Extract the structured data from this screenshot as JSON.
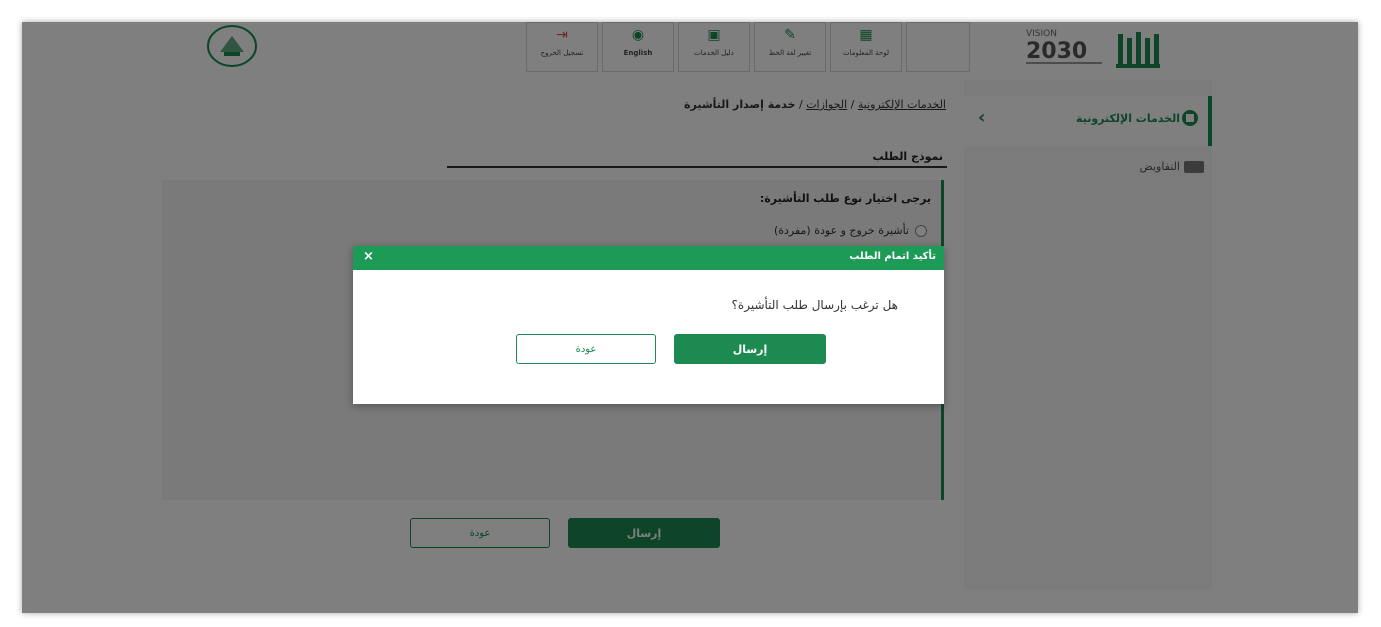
{
  "header": {
    "topbar": [
      {
        "icon": "logout-icon",
        "glyph": "⇥",
        "label": "تسجيل الخروج",
        "color": "#d9534f"
      },
      {
        "icon": "globe-icon",
        "glyph": "◉",
        "label": "English",
        "color": "#1d8a52"
      },
      {
        "icon": "guide-icon",
        "glyph": "▣",
        "label": "دليل الخدمات",
        "color": "#1d8a52"
      },
      {
        "icon": "font-size-icon",
        "glyph": "✎",
        "label": "تغيير لغة الخط",
        "color": "#1d8a52"
      },
      {
        "icon": "dashboard-icon",
        "glyph": "▦",
        "label": "لوحة المعلومات",
        "color": "#1d8a52"
      }
    ]
  },
  "sidebar": {
    "active_label": "الخدمات الإلكترونية",
    "item_label": "التفاويض"
  },
  "breadcrumb": {
    "link1": "الخدمات الإلكترونية",
    "sep": " / ",
    "link2": "الجوازات",
    "current": "خدمة إصدار التأشيرة"
  },
  "form": {
    "title": "نموذج الطلب",
    "question": "يرجى اختيار نوع طلب التأشيرة:",
    "option1": "تأشيرة خروج و عودة (مفردة)",
    "send_label": "إرسال",
    "back_label": "عودة"
  },
  "modal": {
    "title": "تأكيد اتمام الطلب",
    "close": "×",
    "question": "هل ترغب بإرسال طلب التأشيرة؟",
    "send_label": "إرسال",
    "back_label": "عودة"
  },
  "colors": {
    "brand_green": "#1d8a52",
    "modal_header": "#1d9a55",
    "overlay": "rgba(0,0,0,0.5)"
  }
}
